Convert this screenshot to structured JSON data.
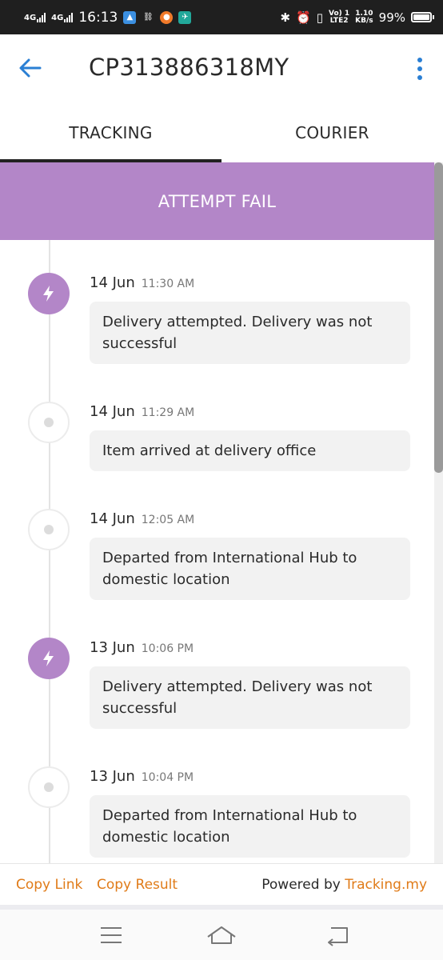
{
  "status_bar": {
    "net1": "4G",
    "net2": "4G",
    "time": "16:13",
    "volte_top": "Vo) 1",
    "volte_bottom": "LTE2",
    "speed_top": "1.10",
    "speed_bottom": "KB/s",
    "battery": "99%"
  },
  "header": {
    "title": "CP313886318MY"
  },
  "tabs": [
    {
      "label": "TRACKING",
      "active": true
    },
    {
      "label": "COURIER",
      "active": false
    }
  ],
  "banner": {
    "status": "ATTEMPT FAIL",
    "color": "#b386c8"
  },
  "events": [
    {
      "date": "14 Jun",
      "time": "11:30 AM",
      "text": "Delivery attempted. Delivery was not successful",
      "icon": "lightning-icon"
    },
    {
      "date": "14 Jun",
      "time": "11:29 AM",
      "text": "Item arrived at delivery office",
      "icon": "dot-icon"
    },
    {
      "date": "14 Jun",
      "time": "12:05 AM",
      "text": "Departed from International Hub to domestic location",
      "icon": "dot-icon"
    },
    {
      "date": "13 Jun",
      "time": "10:06 PM",
      "text": "Delivery attempted. Delivery was not successful",
      "icon": "lightning-icon"
    },
    {
      "date": "13 Jun",
      "time": "10:04 PM",
      "text": "Departed from International Hub to domestic location",
      "icon": "dot-icon"
    }
  ],
  "footer": {
    "copy_link": "Copy Link",
    "copy_result": "Copy Result",
    "powered_by": "Powered by",
    "brand": "Tracking.my",
    "accent": "#e07b18"
  }
}
